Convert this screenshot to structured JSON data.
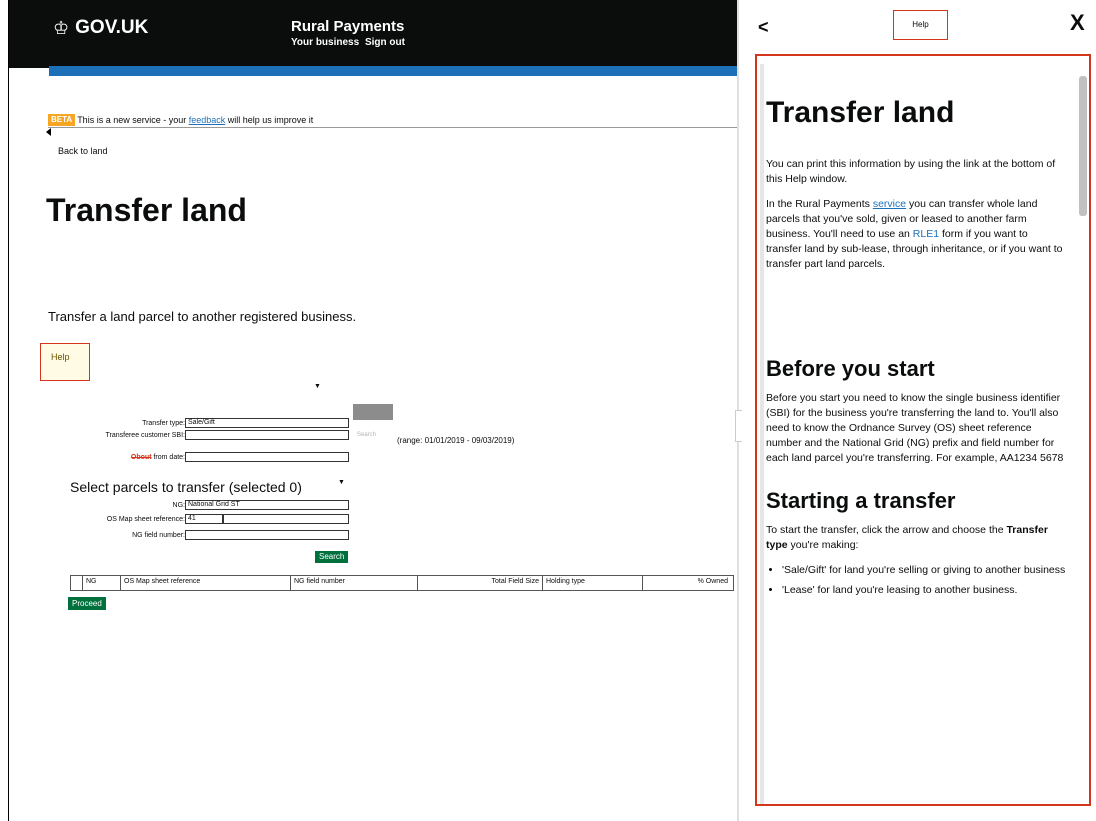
{
  "header": {
    "logo_text": "GOV.UK",
    "service_title": "Rural Payments",
    "links": [
      "Your business",
      "Sign out"
    ]
  },
  "beta": {
    "tag": "BETA",
    "text_before": "This is a new service - your ",
    "link": "feedback",
    "text_after": " will help us improve it"
  },
  "nav": {
    "back_link": "Back to land"
  },
  "page": {
    "title": "Transfer land",
    "lede": "Transfer a land parcel to another registered business.",
    "help_button": "Help"
  },
  "form": {
    "transfer_type_label": "Transfer type:",
    "transfer_type_value": "Sale/Gift",
    "sbi_label": "Transferee customer SBI:",
    "sbi_value": "",
    "date_label_overlay": "Obout",
    "date_label_rest": "from date:",
    "search_label": "Search",
    "range": "(range: 01/01/2019 - 09/03/2019)",
    "parcels_title": "Select parcels to transfer (selected 0)",
    "ng_label": "NG:",
    "ng_value": "National Grid ST",
    "os_label": "OS Map sheet reference:",
    "os_value": "41",
    "field_label": "NG field number:",
    "search_button": "Search"
  },
  "table": {
    "headers": [
      "",
      "NG",
      "OS Map sheet reference",
      "NG field number",
      "Total Field Size",
      "Holding type",
      "% Owned"
    ]
  },
  "proceed_button": "Proceed",
  "help_panel": {
    "back": "<",
    "title": "Help",
    "close": "X",
    "heading": "Transfer land",
    "intro": "You can print this information by using the link at the bottom of this Help window.",
    "p1_a": "In the Rural Payments ",
    "p1_link": "service",
    "p1_b": " you can transfer whole land parcels that you've sold, given or leased to another farm business. You'll need to use an ",
    "p1_link2": "RLE1",
    "p1_c": " form if you want to transfer land by sub-lease, through inheritance, or if you want to transfer part land parcels.",
    "h_before": "Before you start",
    "p_before": "Before you start you need to know the single business identifier (SBI) for the business you're transferring the land to. You'll also need to know the Ordnance Survey (OS) sheet reference number and the National Grid (NG) prefix and field number for each land parcel you're transferring. For example, AA1234 5678",
    "h_start": "Starting a transfer",
    "p_start_a": "To start the transfer, click the arrow and choose the ",
    "p_start_bold": "Transfer type",
    "p_start_b": " you're making:",
    "bullets": [
      "'Sale/Gift' for land you're selling or giving to another business",
      "'Lease' for land you're leasing to another business."
    ]
  },
  "colors": {
    "header_bg": "#0b0c0c",
    "blue_bar": "#1d70b8",
    "green_button": "#00703c",
    "highlight_red": "#d4351c",
    "beta_orange": "#f6a623"
  }
}
